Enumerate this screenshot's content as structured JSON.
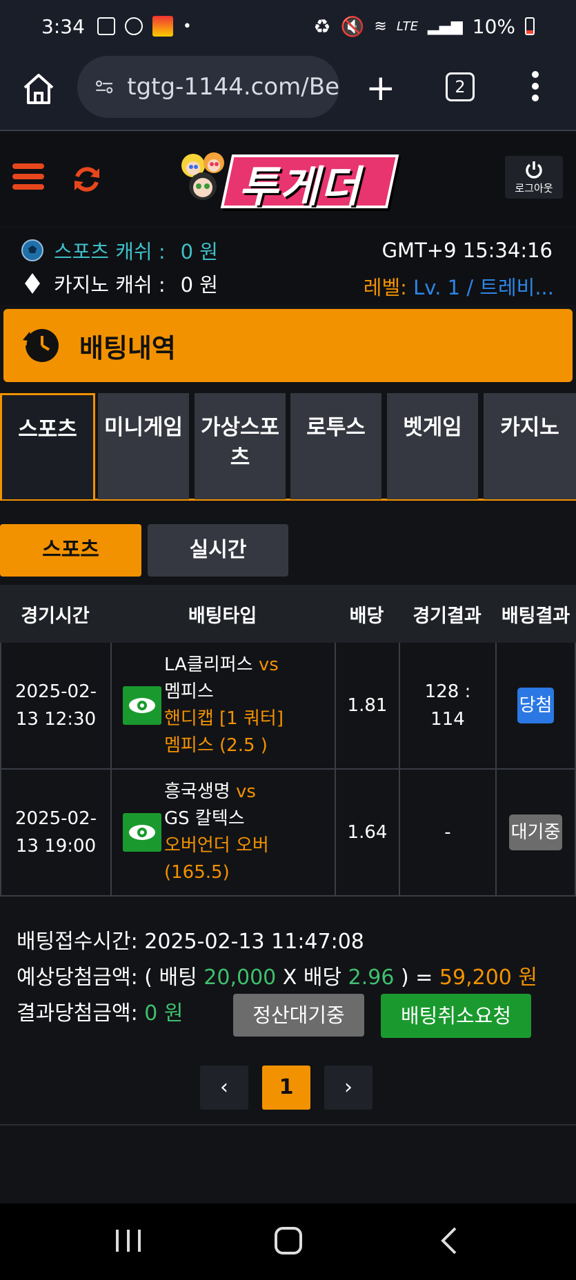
{
  "status_bar": {
    "time": "3:34",
    "battery": "10%",
    "network": "LTE"
  },
  "browser": {
    "url": "tgtg-1144.com/Be",
    "tab_count": "2"
  },
  "header": {
    "logo_text": "투게더",
    "logout_label": "로그아웃"
  },
  "cash": {
    "sports_label": "스포츠 캐쉬 :",
    "sports_value": "0 원",
    "casino_label": "카지노 캐쉬 :",
    "casino_value": "0 원",
    "clock": "GMT+9 15:34:16",
    "level_label": "레벨:",
    "level_value": "Lv. 1 / 트레비..."
  },
  "page_title": "배팅내역",
  "category_tabs": [
    {
      "label": "스포츠",
      "active": true
    },
    {
      "label": "미니게임"
    },
    {
      "label": "가상스포츠"
    },
    {
      "label": "로투스"
    },
    {
      "label": "벳게임"
    },
    {
      "label": "카지노"
    }
  ],
  "sub_tabs": {
    "sports": "스포츠",
    "live": "실시간"
  },
  "table": {
    "headers": [
      "경기시간",
      "배팅타입",
      "배당",
      "경기결과",
      "배팅결과"
    ],
    "rows": [
      {
        "date": "2025-02-",
        "time": "13 12:30",
        "home": "LA클리퍼스",
        "vs": "vs",
        "away": "멤피스",
        "market": "핸디캡 [1 쿼터]",
        "pick": "멤피스 (2.5 )",
        "odds": "1.81",
        "score_a": "128 :",
        "score_b": "114",
        "result": "당첨"
      },
      {
        "date": "2025-02-",
        "time": "13 19:00",
        "home": "흥국생명",
        "vs": "vs",
        "away": "GS 칼텍스",
        "market": "오버언더 오버",
        "pick": "(165.5)",
        "odds": "1.64",
        "score_a": "-",
        "score_b": "",
        "result": "대기중"
      }
    ]
  },
  "summary": {
    "received_label": "배팅접수시간:",
    "received_value": "2025-02-13 11:47:08",
    "expected_label": "예상당첨금액:",
    "expected_open": "( 배팅",
    "bet_amount": "20,000",
    "x_label": "X 배당",
    "total_odds": "2.96",
    "expected_close": ") =",
    "expected_value": "59,200 원",
    "result_label": "결과당첨금액:",
    "result_value": "0 원"
  },
  "buttons": {
    "settle": "정산대기중",
    "cancel": "배팅취소요청"
  },
  "pagination": {
    "prev": "‹",
    "current": "1",
    "next": "›"
  },
  "colors": {
    "accent": "#f39200",
    "win": "#2b78e4",
    "pending": "#6c6c6c",
    "green": "#1a9a2e",
    "cyan": "#3fc0c9"
  }
}
